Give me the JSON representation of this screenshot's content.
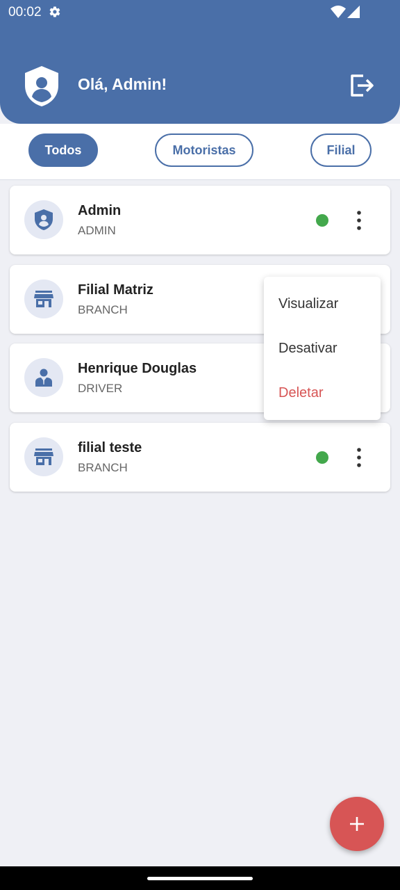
{
  "status_bar": {
    "time": "00:02"
  },
  "header": {
    "greeting": "Olá, Admin!"
  },
  "filters": [
    {
      "label": "Todos",
      "active": true
    },
    {
      "label": "Motoristas",
      "active": false
    },
    {
      "label": "Filial",
      "active": false
    }
  ],
  "users": [
    {
      "name": "Admin",
      "role": "ADMIN",
      "icon": "shield-icon",
      "status": "active"
    },
    {
      "name": "Filial Matriz",
      "role": "BRANCH",
      "icon": "store-icon",
      "status": "active"
    },
    {
      "name": "Henrique Douglas",
      "role": "DRIVER",
      "icon": "driver-icon",
      "status": "active"
    },
    {
      "name": "filial teste",
      "role": "BRANCH",
      "icon": "store-icon",
      "status": "active"
    }
  ],
  "context_menu": {
    "items": [
      "Visualizar",
      "Desativar",
      "Deletar"
    ]
  },
  "colors": {
    "primary": "#4a6fa8",
    "danger": "#d75555",
    "status_active": "#43a84c",
    "background": "#eff0f5"
  }
}
